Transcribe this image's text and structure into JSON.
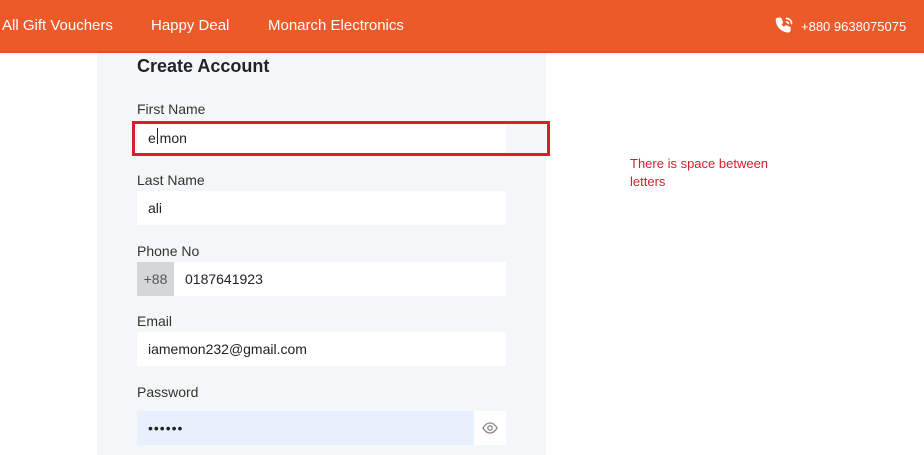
{
  "header": {
    "nav": [
      "All Gift Vouchers",
      "Happy Deal",
      "Monarch Electronics"
    ],
    "phone": "+880 9638075075",
    "phone_icon": "phone-call-icon",
    "background": "#ed5a2a"
  },
  "form": {
    "title": "Create Account",
    "first_name": {
      "label": "First Name",
      "value": "e mon"
    },
    "last_name": {
      "label": "Last Name",
      "value": "ali"
    },
    "phone": {
      "label": "Phone No",
      "prefix": "+88",
      "value": "0187641923"
    },
    "email": {
      "label": "Email",
      "value": "iamemon232@gmail.com"
    },
    "password": {
      "label": "Password",
      "value": "••••••",
      "toggle_icon": "eye-icon"
    }
  },
  "annotation": {
    "text": "There is space between letters",
    "color": "#d71e2a"
  }
}
